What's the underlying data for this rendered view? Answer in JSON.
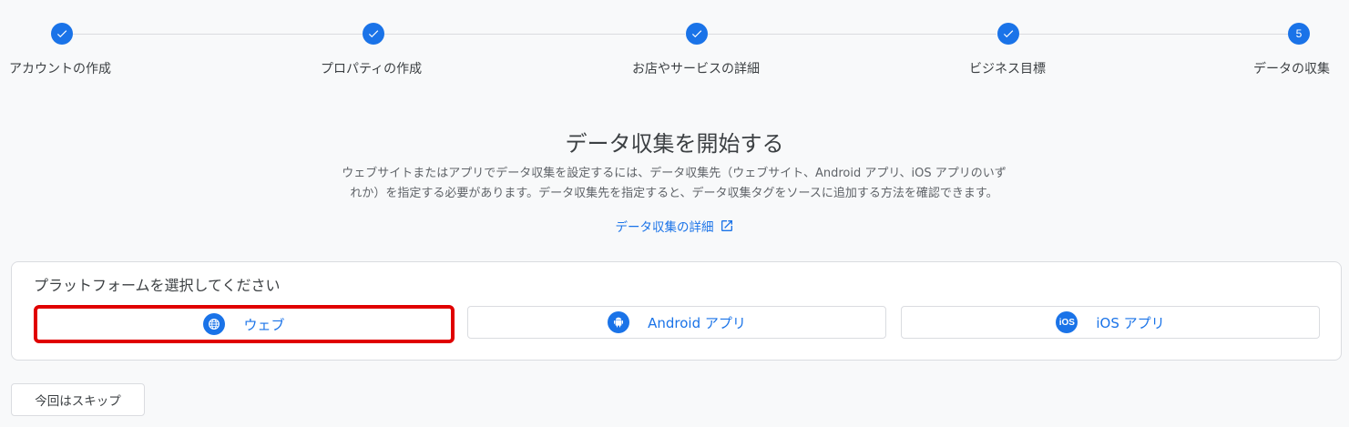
{
  "steps": [
    {
      "label": "アカウントの作成",
      "state": "done"
    },
    {
      "label": "プロパティの作成",
      "state": "done"
    },
    {
      "label": "お店やサービスの詳細",
      "state": "done"
    },
    {
      "label": "ビジネス目標",
      "state": "done"
    },
    {
      "label": "データの収集",
      "state": "current",
      "number": "5"
    }
  ],
  "main": {
    "heading": "データ収集を開始する",
    "description_line1": "ウェブサイトまたはアプリでデータ収集を設定するには、データ収集先（ウェブサイト、Android アプリ、iOS アプリのいず",
    "description_line2": "れか）を指定する必要があります。データ収集先を指定すると、データ収集タグをソースに追加する方法を確認できます。",
    "detail_link": "データ収集の詳細"
  },
  "platform": {
    "title": "プラットフォームを選択してください",
    "options": [
      {
        "label": "ウェブ",
        "icon": "globe-icon",
        "selected": true
      },
      {
        "label": "Android アプリ",
        "icon": "android-icon",
        "selected": false
      },
      {
        "label": "iOS アプリ",
        "icon": "ios-icon",
        "icon_text": "iOS",
        "selected": false
      }
    ]
  },
  "skip_label": "今回はスキップ",
  "colors": {
    "accent": "#1a73e8",
    "highlight": "#e00000",
    "background": "#f8f9fa"
  }
}
